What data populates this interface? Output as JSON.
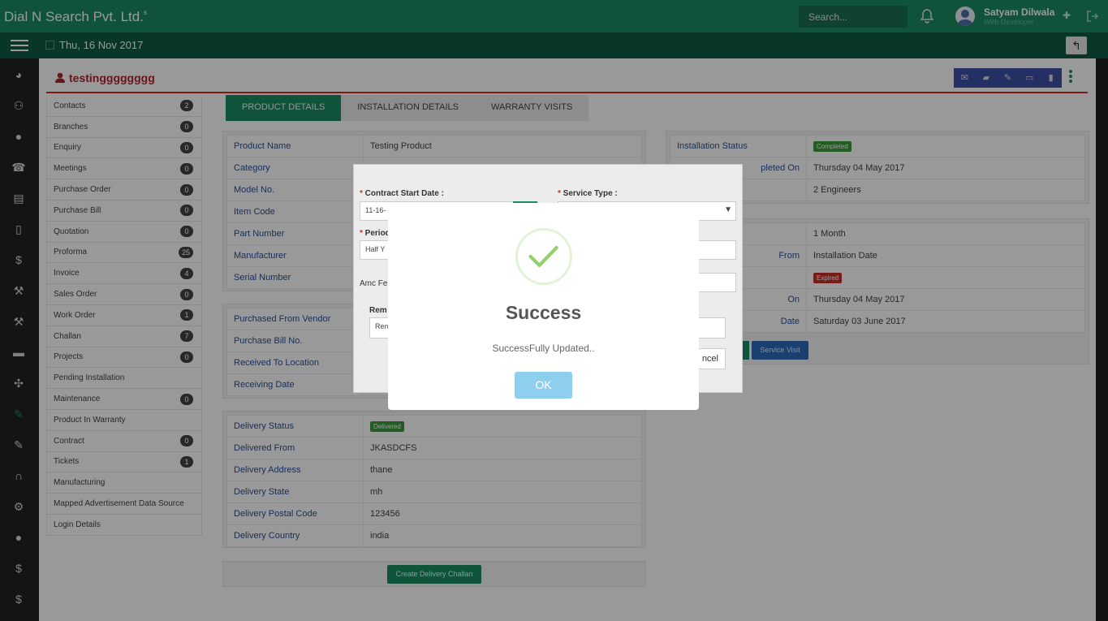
{
  "app": {
    "brand": "Dial N Search Pvt. Ltd.",
    "brand_mark": "s"
  },
  "header": {
    "search_placeholder": "Search...",
    "user_name": "Satyam Dilwala",
    "user_role": "Web Developer",
    "date": "Thu, 16 Nov 2017"
  },
  "record": {
    "title": "testingggggggg"
  },
  "menu": [
    {
      "label": "Contacts",
      "count": "2"
    },
    {
      "label": "Branches",
      "count": "0"
    },
    {
      "label": "Enquiry",
      "count": "0"
    },
    {
      "label": "Meetings",
      "count": "0"
    },
    {
      "label": "Purchase Order",
      "count": "0"
    },
    {
      "label": "Purchase Bill",
      "count": "0"
    },
    {
      "label": "Quotation",
      "count": "0"
    },
    {
      "label": "Proforma",
      "count": "25"
    },
    {
      "label": "Invoice",
      "count": "4"
    },
    {
      "label": "Sales Order",
      "count": "0"
    },
    {
      "label": "Work Order",
      "count": "1"
    },
    {
      "label": "Challan",
      "count": "7"
    },
    {
      "label": "Projects",
      "count": "0"
    },
    {
      "label": "Pending Installation",
      "count": ""
    },
    {
      "label": "Maintenance",
      "count": "0"
    },
    {
      "label": "Product In Warranty",
      "count": ""
    },
    {
      "label": "Contract",
      "count": "0"
    },
    {
      "label": "Tickets",
      "count": "1"
    },
    {
      "label": "Manufacturing",
      "count": ""
    },
    {
      "label": "Mapped Advertisement Data Source",
      "count": ""
    },
    {
      "label": "Login Details",
      "count": ""
    }
  ],
  "tabs": [
    "PRODUCT DETAILS",
    "INSTALLATION DETAILS",
    "WARRANTY VISITS"
  ],
  "product": {
    "rows": [
      {
        "label": "Product Name",
        "value": "Testing Product"
      },
      {
        "label": "Category",
        "value": ""
      },
      {
        "label": "Model No.",
        "value": ""
      },
      {
        "label": "Item Code",
        "value": ""
      },
      {
        "label": "Part Number",
        "value": ""
      },
      {
        "label": "Manufacturer",
        "value": ""
      },
      {
        "label": "Serial Number",
        "value": ""
      }
    ]
  },
  "purchase": {
    "rows": [
      {
        "label": "Purchased From Vendor",
        "value": ""
      },
      {
        "label": "Purchase Bill No.",
        "value": ""
      },
      {
        "label": "Received To Location",
        "value": ""
      },
      {
        "label": "Receiving Date",
        "value": ""
      }
    ]
  },
  "delivery": {
    "status_label": "Delivery Status",
    "status_badge": "Delivered",
    "rows": [
      {
        "label": "Delivered From",
        "value": "JKASDCFS"
      },
      {
        "label": "Delivery Address",
        "value": "thane"
      },
      {
        "label": "Delivery State",
        "value": "mh"
      },
      {
        "label": "Delivery Postal Code",
        "value": "123456"
      },
      {
        "label": "Delivery Country",
        "value": "india"
      }
    ],
    "button": "Create Delivery Challan"
  },
  "installation": {
    "status_label": "Installation Status",
    "status_badge": "Completed",
    "completed_label": "pleted On",
    "completed_value": "Thursday 04 May 2017",
    "engineers_value": "2 Engineers"
  },
  "warranty": {
    "period_value": "1 Month",
    "from_label": "From",
    "from_value": "Installation Date",
    "status_badge": "Expired",
    "on_label": "On",
    "on_value": "Thursday 04 May 2017",
    "date_label": "Date",
    "date_value": "Saturday 03 June 2017",
    "service_visit_button": "Service Visit"
  },
  "under_modal": {
    "contract_start_label": "Contract Start Date :",
    "contract_start_value": "11-16-",
    "service_type_label": "Service Type :",
    "period_label": "Period",
    "period_value": "Half Y",
    "amc_label": "Amc Fe",
    "remark_label": "Rem",
    "remark_placeholder": "Rem",
    "cancel_label": "ncel"
  },
  "dialog": {
    "title": "Success",
    "message": "SuccessFully Updated..",
    "ok": "OK"
  },
  "colors": {
    "brand_green": "#1b8a63",
    "dark_green": "#0e5a44",
    "title_red": "#b0252d",
    "label_blue": "#2b4f95"
  }
}
